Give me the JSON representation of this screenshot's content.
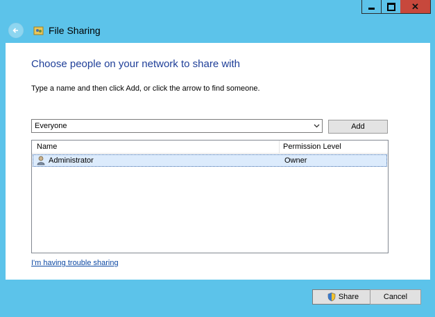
{
  "window": {
    "title": "File Sharing",
    "controls": {
      "minimize": "minimize-icon",
      "maximize": "maximize-icon",
      "close": "✕"
    }
  },
  "main": {
    "heading": "Choose people on your network to share with",
    "instruction": "Type a name and then click Add, or click the arrow to find someone.",
    "combo_value": "Everyone",
    "add_label": "Add",
    "list": {
      "columns": [
        "Name",
        "Permission Level"
      ],
      "rows": [
        {
          "name": "Administrator",
          "permission": "Owner",
          "icon": "user-icon",
          "selected": true
        }
      ]
    },
    "trouble_link": "I'm having trouble sharing"
  },
  "footer": {
    "share_label": "Share",
    "cancel_label": "Cancel"
  },
  "colors": {
    "frame": "#5cc3ea",
    "heading": "#1e3e98",
    "link": "#0c48a3",
    "selection": "#dcebfc",
    "close_button": "#c7483c"
  }
}
